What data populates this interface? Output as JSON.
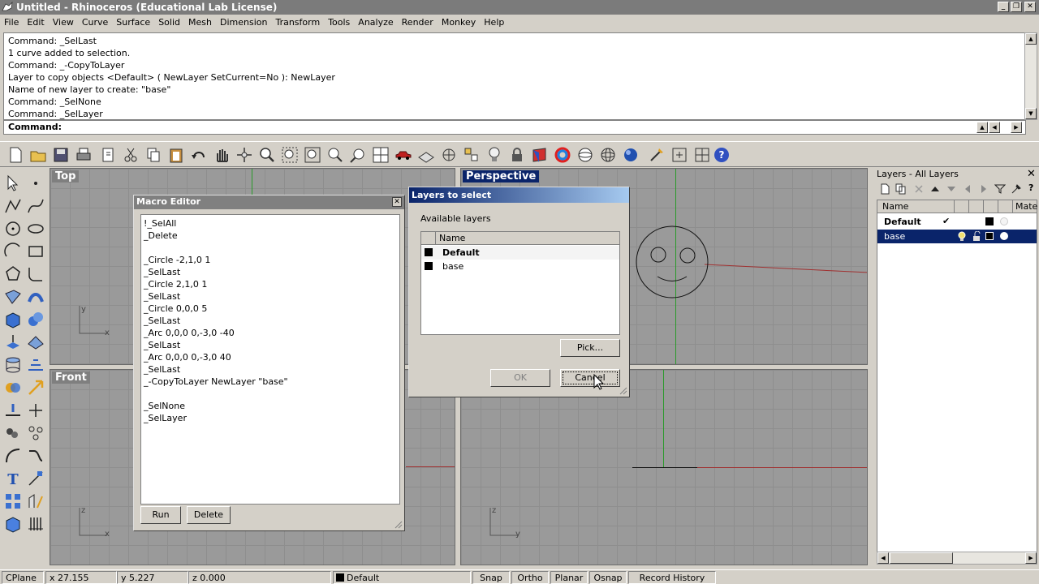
{
  "window": {
    "title": "Untitled - Rhinoceros (Educational Lab License)"
  },
  "menu": [
    "File",
    "Edit",
    "View",
    "Curve",
    "Surface",
    "Solid",
    "Mesh",
    "Dimension",
    "Transform",
    "Tools",
    "Analyze",
    "Render",
    "Monkey",
    "Help"
  ],
  "command_history": [
    "Command: _SelLast",
    "1 curve added to selection.",
    "Command: _-CopyToLayer",
    "Layer to copy objects <Default> ( NewLayer  SetCurrent=No ): NewLayer",
    "Name of new layer to create: \"base\"",
    "Command: _SelNone",
    "Command: _SelLayer"
  ],
  "command_prompt": "Command:",
  "viewports": {
    "top": "Top",
    "perspective": "Perspective",
    "front": "Front",
    "right_axis": "y"
  },
  "axis_labels": {
    "x": "x",
    "y": "y",
    "z": "z"
  },
  "macro_editor": {
    "title": "Macro Editor",
    "lines": [
      "!_SelAll",
      "_Delete",
      "",
      "_Circle -2,1,0 1",
      "_SelLast",
      "_Circle 2,1,0 1",
      "_SelLast",
      "_Circle 0,0,0 5",
      "_SelLast",
      "_Arc 0,0,0 0,-3,0 -40",
      "_SelLast",
      "_Arc 0,0,0 0,-3,0 40",
      "_SelLast",
      "_-CopyToLayer NewLayer \"base\"",
      "",
      "_SelNone",
      "_SelLayer"
    ],
    "run_label": "Run",
    "delete_label": "Delete"
  },
  "layers_dialog": {
    "title": "Layers to select",
    "available_label": "Available layers",
    "column_name": "Name",
    "layers": [
      "Default",
      "base"
    ],
    "pick_label": "Pick...",
    "ok_label": "OK",
    "cancel_label": "Cancel"
  },
  "layers_panel": {
    "title": "Layers - All Layers",
    "col_name": "Name",
    "col_material": "Mate",
    "rows": [
      {
        "name": "Default",
        "current": "✔"
      },
      {
        "name": "base",
        "current": ""
      }
    ]
  },
  "statusbar": {
    "cplane": "CPlane",
    "x": "x 27.155",
    "y": "y 5.227",
    "z": "z 0.000",
    "layer": "Default",
    "snap": "Snap",
    "ortho": "Ortho",
    "planar": "Planar",
    "osnap": "Osnap",
    "record": "Record History"
  },
  "colors": {
    "accent": "#0a246a",
    "selection": "#0a246a",
    "axis_red": "#a03030",
    "axis_green": "#2a9a2a"
  }
}
